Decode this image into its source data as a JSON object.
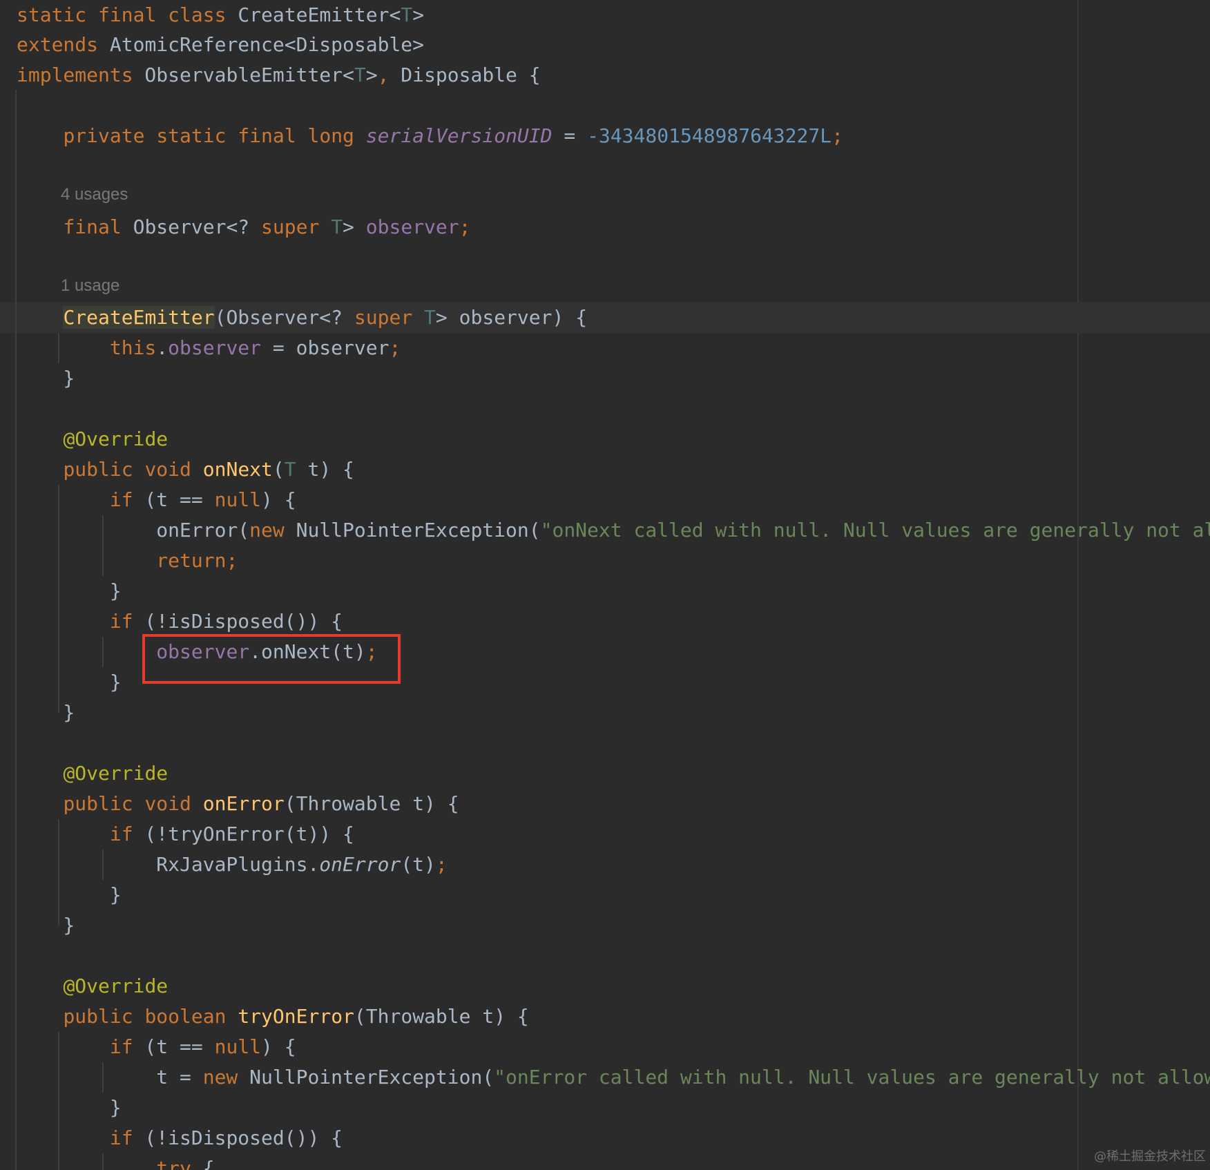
{
  "editor": {
    "language": "Java",
    "theme": "dark",
    "colors": {
      "background": "#2b2b2b",
      "keyword": "#cc7832",
      "type_parameter": "#507874",
      "field": "#9876aa",
      "number": "#6897bb",
      "method_declaration": "#ffc66d",
      "annotation": "#bbb529",
      "string": "#6a8759",
      "plain": "#a9b7c6",
      "usage_hint": "#787878",
      "highlight_box": "#e53a2c"
    },
    "highlighted_statement": "observer.onNext(t);",
    "usage_hints": [
      "4 usages",
      "1 usage"
    ],
    "lines": [
      {
        "tokens": [
          {
            "t": "static",
            "c": "keyword"
          },
          {
            "t": " ",
            "c": "plain"
          },
          {
            "t": "final",
            "c": "keyword"
          },
          {
            "t": " ",
            "c": "plain"
          },
          {
            "t": "class",
            "c": "keyword"
          },
          {
            "t": " CreateEmitter<",
            "c": "plain"
          },
          {
            "t": "T",
            "c": "type-param"
          },
          {
            "t": ">",
            "c": "plain"
          }
        ]
      },
      {
        "tokens": [
          {
            "t": "extends",
            "c": "keyword"
          },
          {
            "t": " AtomicReference<Disposable>",
            "c": "plain"
          }
        ]
      },
      {
        "tokens": [
          {
            "t": "implements",
            "c": "keyword"
          },
          {
            "t": " ObservableEmitter<",
            "c": "plain"
          },
          {
            "t": "T",
            "c": "type-param"
          },
          {
            "t": ">",
            "c": "plain"
          },
          {
            "t": ",",
            "c": "keyword"
          },
          {
            "t": " Disposable {",
            "c": "plain"
          }
        ]
      },
      {
        "tokens": [
          {
            "t": "    ",
            "c": "plain"
          },
          {
            "t": "private",
            "c": "keyword"
          },
          {
            "t": " ",
            "c": "plain"
          },
          {
            "t": "static",
            "c": "keyword"
          },
          {
            "t": " ",
            "c": "plain"
          },
          {
            "t": "final",
            "c": "keyword"
          },
          {
            "t": " ",
            "c": "plain"
          },
          {
            "t": "long",
            "c": "keyword"
          },
          {
            "t": " ",
            "c": "plain"
          },
          {
            "t": "serialVersionUID",
            "c": "static-field"
          },
          {
            "t": " = ",
            "c": "plain"
          },
          {
            "t": "-3434801548987643227L",
            "c": "number"
          },
          {
            "t": ";",
            "c": "keyword"
          }
        ]
      },
      {
        "tokens": [
          {
            "t": "    ",
            "c": "plain"
          },
          {
            "t": "final",
            "c": "keyword"
          },
          {
            "t": " Observer<? ",
            "c": "plain"
          },
          {
            "t": "super",
            "c": "keyword"
          },
          {
            "t": " ",
            "c": "plain"
          },
          {
            "t": "T",
            "c": "type-param"
          },
          {
            "t": "> ",
            "c": "plain"
          },
          {
            "t": "observer",
            "c": "field"
          },
          {
            "t": ";",
            "c": "keyword"
          }
        ]
      },
      {
        "tokens": [
          {
            "t": "    ",
            "c": "plain"
          },
          {
            "t": "CreateEmitter",
            "c": "method-decl ctor-highlight"
          },
          {
            "t": "(Observer<? ",
            "c": "plain"
          },
          {
            "t": "super",
            "c": "keyword"
          },
          {
            "t": " ",
            "c": "plain"
          },
          {
            "t": "T",
            "c": "type-param"
          },
          {
            "t": "> observer) {",
            "c": "plain"
          }
        ]
      },
      {
        "tokens": [
          {
            "t": "        ",
            "c": "plain"
          },
          {
            "t": "this",
            "c": "keyword"
          },
          {
            "t": ".",
            "c": "plain"
          },
          {
            "t": "observer",
            "c": "field"
          },
          {
            "t": " = observer",
            "c": "plain"
          },
          {
            "t": ";",
            "c": "keyword"
          }
        ]
      },
      {
        "tokens": [
          {
            "t": "    }",
            "c": "plain"
          }
        ]
      },
      {
        "tokens": [
          {
            "t": "    ",
            "c": "plain"
          },
          {
            "t": "@Override",
            "c": "annotation"
          }
        ]
      },
      {
        "tokens": [
          {
            "t": "    ",
            "c": "plain"
          },
          {
            "t": "public",
            "c": "keyword"
          },
          {
            "t": " ",
            "c": "plain"
          },
          {
            "t": "void",
            "c": "keyword"
          },
          {
            "t": " ",
            "c": "plain"
          },
          {
            "t": "onNext",
            "c": "method-decl"
          },
          {
            "t": "(",
            "c": "plain"
          },
          {
            "t": "T",
            "c": "type-param"
          },
          {
            "t": " t) {",
            "c": "plain"
          }
        ]
      },
      {
        "tokens": [
          {
            "t": "        ",
            "c": "plain"
          },
          {
            "t": "if",
            "c": "keyword"
          },
          {
            "t": " (t == ",
            "c": "plain"
          },
          {
            "t": "null",
            "c": "keyword"
          },
          {
            "t": ") {",
            "c": "plain"
          }
        ]
      },
      {
        "tokens": [
          {
            "t": "            onError(",
            "c": "plain"
          },
          {
            "t": "new",
            "c": "keyword"
          },
          {
            "t": " NullPointerException(",
            "c": "plain"
          },
          {
            "t": "\"onNext called with null. Null values are generally not allowed",
            "c": "string"
          }
        ]
      },
      {
        "tokens": [
          {
            "t": "            ",
            "c": "plain"
          },
          {
            "t": "return;",
            "c": "keyword"
          }
        ]
      },
      {
        "tokens": [
          {
            "t": "        }",
            "c": "plain"
          }
        ]
      },
      {
        "tokens": [
          {
            "t": "        ",
            "c": "plain"
          },
          {
            "t": "if",
            "c": "keyword"
          },
          {
            "t": " (!isDisposed()) {",
            "c": "plain"
          }
        ]
      },
      {
        "tokens": [
          {
            "t": "            ",
            "c": "plain"
          },
          {
            "t": "observer",
            "c": "field"
          },
          {
            "t": ".onNext(t)",
            "c": "plain"
          },
          {
            "t": ";",
            "c": "keyword"
          }
        ]
      },
      {
        "tokens": [
          {
            "t": "        }",
            "c": "plain"
          }
        ]
      },
      {
        "tokens": [
          {
            "t": "    }",
            "c": "plain"
          }
        ]
      },
      {
        "tokens": [
          {
            "t": "    ",
            "c": "plain"
          },
          {
            "t": "@Override",
            "c": "annotation"
          }
        ]
      },
      {
        "tokens": [
          {
            "t": "    ",
            "c": "plain"
          },
          {
            "t": "public",
            "c": "keyword"
          },
          {
            "t": " ",
            "c": "plain"
          },
          {
            "t": "void",
            "c": "keyword"
          },
          {
            "t": " ",
            "c": "plain"
          },
          {
            "t": "onError",
            "c": "method-decl"
          },
          {
            "t": "(Throwable t) {",
            "c": "plain"
          }
        ]
      },
      {
        "tokens": [
          {
            "t": "        ",
            "c": "plain"
          },
          {
            "t": "if",
            "c": "keyword"
          },
          {
            "t": " (!tryOnError(t)) {",
            "c": "plain"
          }
        ]
      },
      {
        "tokens": [
          {
            "t": "            RxJavaPlugins.",
            "c": "plain"
          },
          {
            "t": "onError",
            "c": "static-call"
          },
          {
            "t": "(t)",
            "c": "plain"
          },
          {
            "t": ";",
            "c": "keyword"
          }
        ]
      },
      {
        "tokens": [
          {
            "t": "        }",
            "c": "plain"
          }
        ]
      },
      {
        "tokens": [
          {
            "t": "    }",
            "c": "plain"
          }
        ]
      },
      {
        "tokens": [
          {
            "t": "    ",
            "c": "plain"
          },
          {
            "t": "@Override",
            "c": "annotation"
          }
        ]
      },
      {
        "tokens": [
          {
            "t": "    ",
            "c": "plain"
          },
          {
            "t": "public",
            "c": "keyword"
          },
          {
            "t": " ",
            "c": "plain"
          },
          {
            "t": "boolean",
            "c": "keyword"
          },
          {
            "t": " ",
            "c": "plain"
          },
          {
            "t": "tryOnError",
            "c": "method-decl"
          },
          {
            "t": "(Throwable t) {",
            "c": "plain"
          }
        ]
      },
      {
        "tokens": [
          {
            "t": "        ",
            "c": "plain"
          },
          {
            "t": "if",
            "c": "keyword"
          },
          {
            "t": " (t == ",
            "c": "plain"
          },
          {
            "t": "null",
            "c": "keyword"
          },
          {
            "t": ") {",
            "c": "plain"
          }
        ]
      },
      {
        "tokens": [
          {
            "t": "            t = ",
            "c": "plain"
          },
          {
            "t": "new",
            "c": "keyword"
          },
          {
            "t": " NullPointerException(",
            "c": "plain"
          },
          {
            "t": "\"onError called with null. Null values are generally not allowed in",
            "c": "string"
          }
        ]
      },
      {
        "tokens": [
          {
            "t": "        }",
            "c": "plain"
          }
        ]
      },
      {
        "tokens": [
          {
            "t": "        ",
            "c": "plain"
          },
          {
            "t": "if",
            "c": "keyword"
          },
          {
            "t": " (!isDisposed()) {",
            "c": "plain"
          }
        ]
      },
      {
        "tokens": [
          {
            "t": "            ",
            "c": "plain"
          },
          {
            "t": "try",
            "c": "keyword"
          },
          {
            "t": " {",
            "c": "plain"
          }
        ]
      }
    ]
  },
  "watermark": "@稀土掘金技术社区"
}
